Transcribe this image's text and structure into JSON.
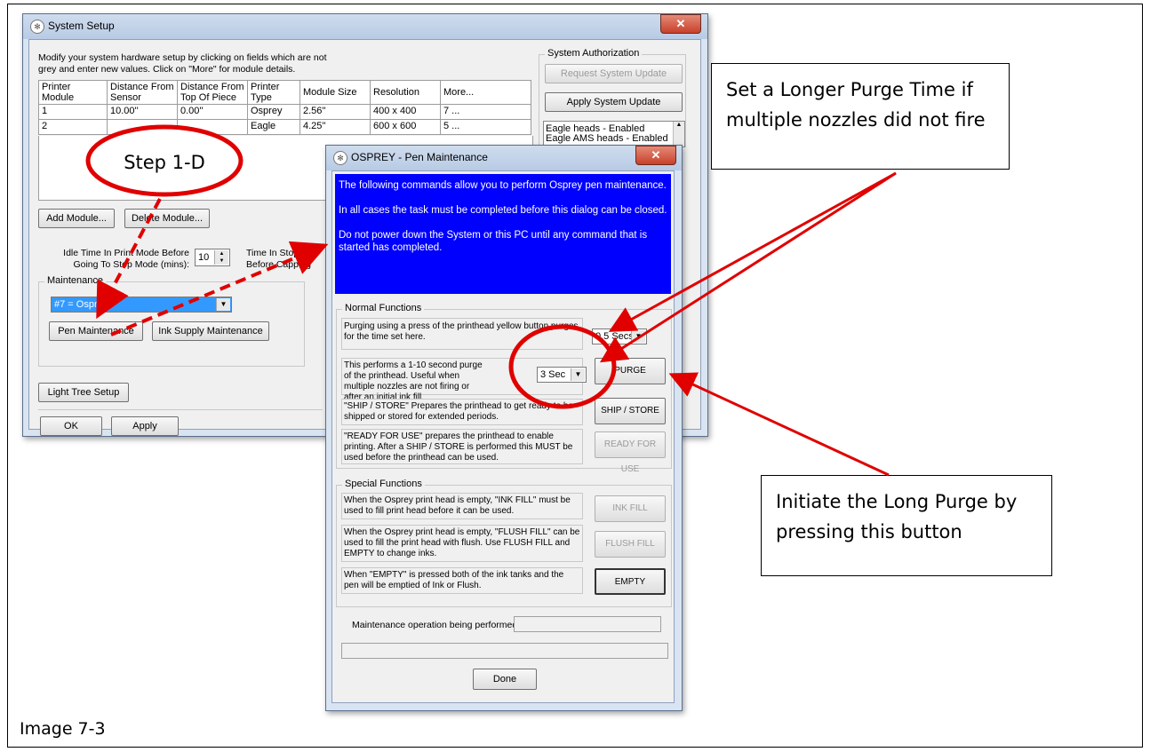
{
  "caption": "Image 7-3",
  "callouts": {
    "top_right": "Set a Longer Purge Time if multiple nozzles did not fire",
    "bottom_right": "Initiate the Long Purge by pressing this button",
    "step": "Step 1-D"
  },
  "system_setup": {
    "title": "System Setup",
    "instructions": "Modify your system hardware setup by clicking on fields which are not grey and enter new values.  Click on \"More\" for module details.",
    "authorization_label": "System Authorization",
    "request_update": "Request System Update",
    "apply_update": "Apply System Update",
    "status_list": [
      "Eagle heads - Enabled",
      "Eagle AMS heads - Enabled"
    ],
    "table": {
      "headers": [
        "Printer Module",
        "Distance From Sensor",
        "Distance From Top Of Piece",
        "Printer Type",
        "Module Size",
        "Resolution",
        "More..."
      ],
      "rows": [
        [
          "1",
          "10.00''",
          "0.00''",
          "Osprey",
          "2.56''",
          "400 x 400",
          "7 ..."
        ],
        [
          "2",
          "",
          "",
          "Eagle",
          "4.25''",
          "600 x 600",
          "5 ..."
        ]
      ]
    },
    "add_module": "Add Module...",
    "delete_module": "Delete Module...",
    "idle_label": "Idle Time In Print Mode Before Going To Stop Mode (mins):",
    "idle_value": "10",
    "time_stopped_label": "Time In Stopped Before Capping",
    "maintenance_label": "Maintenance",
    "maintenance_select": "#7 = Osprey",
    "pen_maintenance": "Pen Maintenance",
    "ink_supply": "Ink Supply Maintenance",
    "light_tree": "Light Tree Setup",
    "ok": "OK",
    "apply": "Apply"
  },
  "pen_dialog": {
    "title": "OSPREY - Pen Maintenance",
    "info": [
      "The following commands allow you to perform Osprey pen maintenance.",
      "In all cases the task must be completed before this dialog can be closed.",
      "Do not power down the System or this PC until any command that is started has completed."
    ],
    "normal_label": "Normal Functions",
    "purge_press_text": "Purging using a press of the printhead yellow button purges for the time set here.",
    "purge_press_value": "0.5 Secs",
    "purge_text": "This performs a 1-10 second purge of the printhead.  Useful when multiple nozzles are not firing or after an initial ink fill.",
    "purge_value": "3 Sec",
    "purge_btn": "PURGE",
    "ship_text": "\"SHIP / STORE\" Prepares the printhead to get ready to be shipped or stored for extended periods.",
    "ship_btn": "SHIP / STORE",
    "ready_text": "\"READY FOR USE\" prepares the printhead to enable printing.  After a SHIP / STORE is performed this MUST be used before the printhead can be used.",
    "ready_btn": "READY FOR USE",
    "special_label": "Special Functions",
    "ink_fill_text": "When the Osprey print head is empty, \"INK FILL\" must be used to fill print head before it can be used.",
    "ink_fill_btn": "INK FILL",
    "flush_text": "When the Osprey print head is empty, \"FLUSH FILL\" can be used to fill the print head with flush.  Use FLUSH FILL and EMPTY to change inks.",
    "flush_btn": "FLUSH FILL",
    "empty_text": "When \"EMPTY\" is pressed both of the ink tanks and the pen will be emptied of Ink or Flush.",
    "empty_btn": "EMPTY",
    "operation_label": "Maintenance operation being performed:",
    "operation_value": "",
    "done": "Done"
  },
  "colors": {
    "annotation": "#e00000",
    "info_bg": "#0000ff"
  }
}
